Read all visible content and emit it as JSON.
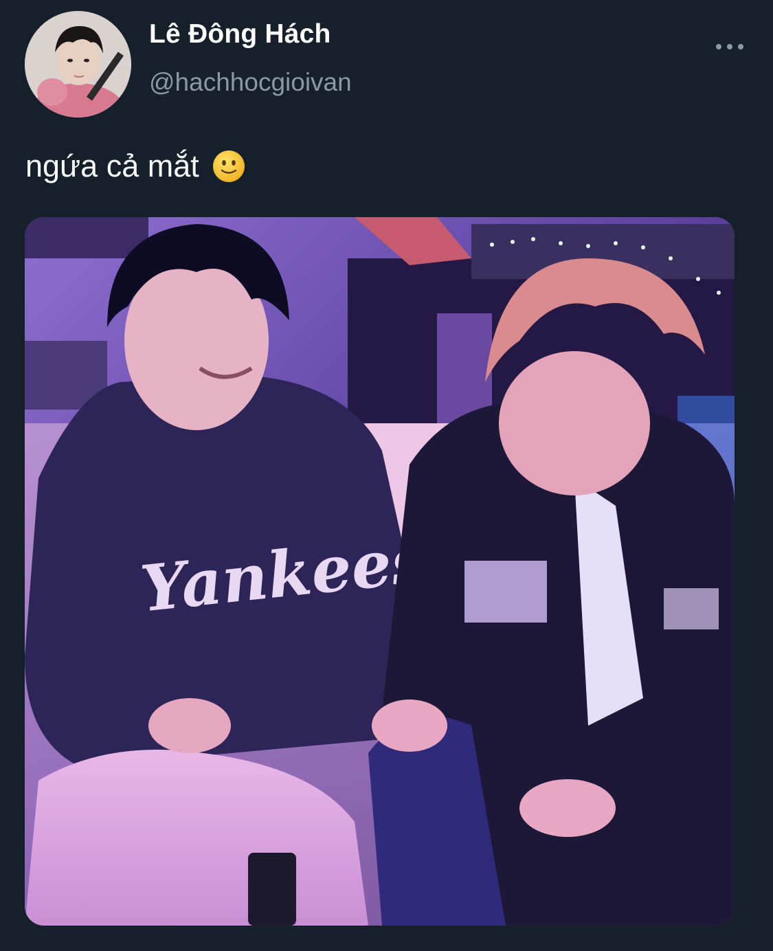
{
  "tweet": {
    "author": {
      "display_name": "Lê Đông Hách",
      "handle": "@hachhocgioivan"
    },
    "text": "ngứa cả mắt",
    "emoji": "slightly-smiling-face",
    "more_icon": "ellipsis-horizontal-icon",
    "media": {
      "type": "photo",
      "sweatshirt_text": "Yankees"
    }
  },
  "colors": {
    "background": "#15202b",
    "name": "#ffffff",
    "handle": "#8b98a5",
    "text": "#f7f9f9"
  }
}
